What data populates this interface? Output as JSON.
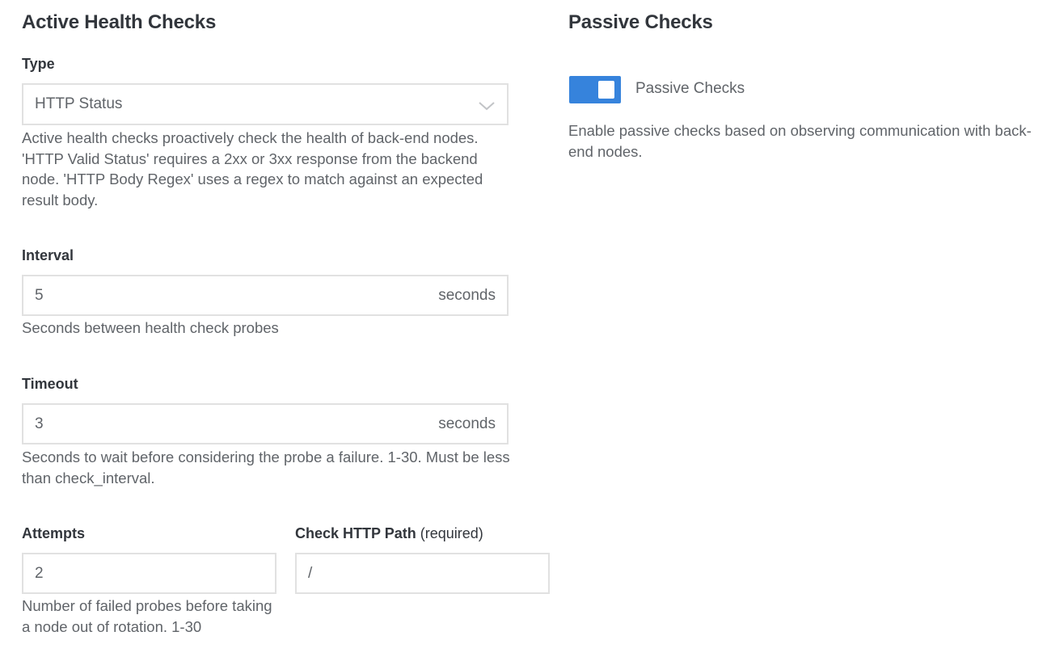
{
  "active": {
    "title": "Active Health Checks",
    "type": {
      "label": "Type",
      "selected": "HTTP Status",
      "help": "Active health checks proactively check the health of back-end nodes. 'HTTP Valid Status' requires a 2xx or 3xx response from the backend node. 'HTTP Body Regex' uses a regex to match against an expected result body."
    },
    "interval": {
      "label": "Interval",
      "value": "5",
      "suffix": "seconds",
      "help": "Seconds between health check probes"
    },
    "timeout": {
      "label": "Timeout",
      "value": "3",
      "suffix": "seconds",
      "help": "Seconds to wait before considering the probe a failure. 1-30. Must be less than check_interval."
    },
    "attempts": {
      "label": "Attempts",
      "value": "2",
      "help": "Number of failed probes before taking a node out of rotation. 1-30"
    },
    "path": {
      "label": "Check HTTP Path",
      "label_note": "(required)",
      "value": "/"
    }
  },
  "passive": {
    "title": "Passive Checks",
    "toggle": {
      "label": "Passive Checks",
      "enabled": true,
      "color": "#3683dc"
    },
    "help": "Enable passive checks based on observing communication with back-end nodes."
  }
}
